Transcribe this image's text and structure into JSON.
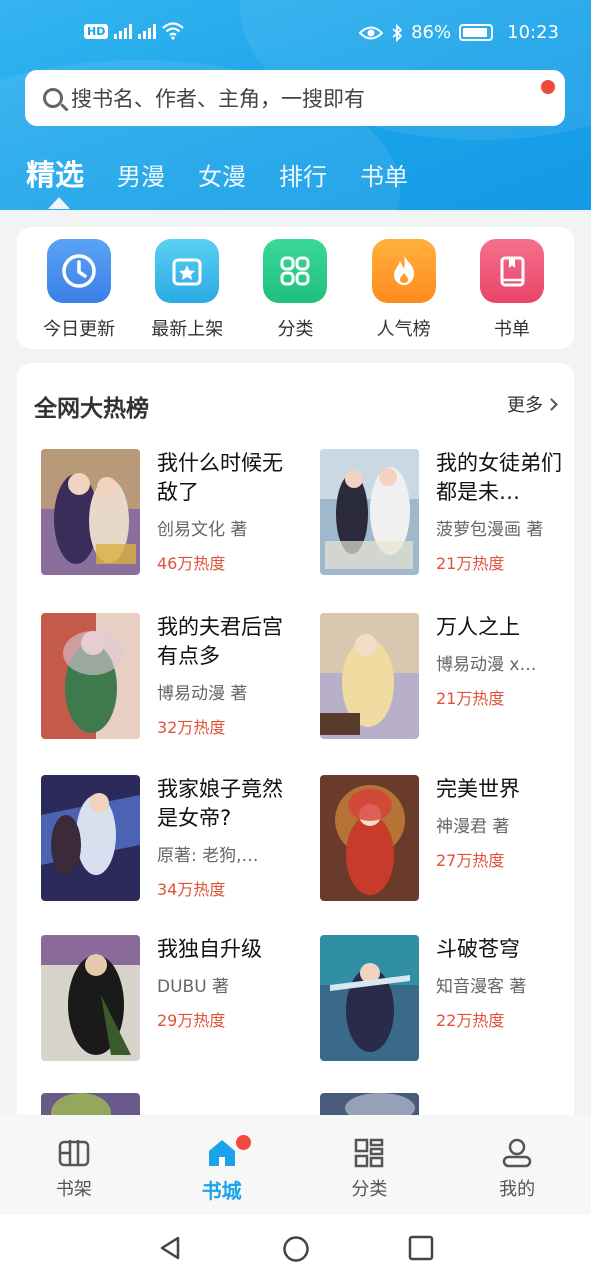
{
  "status_bar": {
    "left_badge": "HD",
    "battery": "86%",
    "time": "10:23"
  },
  "search": {
    "placeholder": "搜书名、作者、主角，一搜即有"
  },
  "tabs": [
    {
      "label": "精选",
      "active": true
    },
    {
      "label": "男漫"
    },
    {
      "label": "女漫"
    },
    {
      "label": "排行"
    },
    {
      "label": "书单"
    }
  ],
  "shortcuts": [
    {
      "label": "今日更新",
      "icon": "clock-icon",
      "color": "#4a90f0"
    },
    {
      "label": "最新上架",
      "icon": "star-box-icon",
      "color": "#35b8e8"
    },
    {
      "label": "分类",
      "icon": "grid-icon",
      "color": "#2ccf8e"
    },
    {
      "label": "人气榜",
      "icon": "fire-icon",
      "color": "#ff9a2e"
    },
    {
      "label": "书单",
      "icon": "book-icon",
      "color": "#ee5a78"
    }
  ],
  "hot_list": {
    "title": "全网大热榜",
    "more": "更多",
    "items": [
      {
        "name": "我什么时候无敌了",
        "author": "创易文化 著",
        "heat": "46万热度"
      },
      {
        "name": "我的女徒弟们都是未…",
        "author": "菠萝包漫画 著",
        "heat": "21万热度"
      },
      {
        "name": "我的夫君后宫有点多",
        "author": "博易动漫 著",
        "heat": "32万热度"
      },
      {
        "name": "万人之上",
        "author": "博易动漫 x…",
        "heat": "21万热度"
      },
      {
        "name": "我家娘子竟然是女帝?",
        "author": "原著: 老狗,…",
        "heat": "34万热度"
      },
      {
        "name": "完美世界",
        "author": "神漫君 著",
        "heat": "27万热度"
      },
      {
        "name": "我独自升级",
        "author": "DUBU 著",
        "heat": "29万热度"
      },
      {
        "name": "斗破苍穹",
        "author": "知音漫客 著",
        "heat": "22万热度"
      }
    ]
  },
  "bottom_nav": [
    {
      "label": "书架",
      "icon": "bookshelf-icon"
    },
    {
      "label": "书城",
      "icon": "home-icon",
      "active": true
    },
    {
      "label": "分类",
      "icon": "category-icon"
    },
    {
      "label": "我的",
      "icon": "user-icon"
    }
  ],
  "colors": {
    "accent": "#1aa3ea",
    "heat": "#e0523a",
    "badge": "#f04a3e"
  }
}
